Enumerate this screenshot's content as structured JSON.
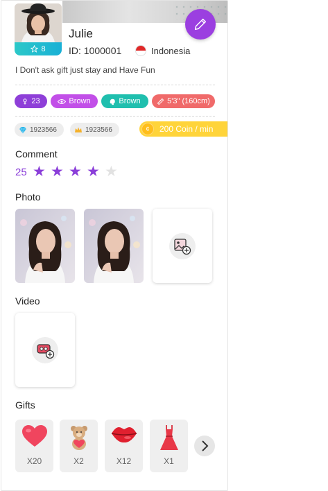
{
  "profile": {
    "name": "Julie",
    "id_text": "ID: 1000001",
    "country": "Indonesia",
    "level": "8",
    "bio": "I Don't ask gift just stay and Have Fun"
  },
  "tags": [
    {
      "label": "23",
      "icon": "gender-icon",
      "color": "#8e3fd8"
    },
    {
      "label": "Brown",
      "icon": "eye-icon",
      "color": "#c24fe8"
    },
    {
      "label": "Brown",
      "icon": "hair-icon",
      "color": "#1fbfae"
    },
    {
      "label": "5'3\" (160cm)",
      "icon": "ruler-icon",
      "color": "#f06a6a"
    }
  ],
  "stats": {
    "diamonds": "1923566",
    "charm": "1923566",
    "price": "200 Coin / min"
  },
  "sections": {
    "comment": "Comment",
    "photo": "Photo",
    "video": "Video",
    "gifts": "Gifts"
  },
  "rating": {
    "count": "25",
    "stars": 4,
    "max": 5
  },
  "gifts": [
    {
      "icon": "heart-icon",
      "count": "X20"
    },
    {
      "icon": "teddy-bear-icon",
      "count": "X2"
    },
    {
      "icon": "lips-icon",
      "count": "X12"
    },
    {
      "icon": "dress-icon",
      "count": "X1"
    }
  ],
  "colors": {
    "accent": "#9b3fe0",
    "star_on": "#8b3fd9",
    "star_off": "#e2e2e2",
    "coin": "#ffd43a",
    "badge": "#19b0d6"
  }
}
